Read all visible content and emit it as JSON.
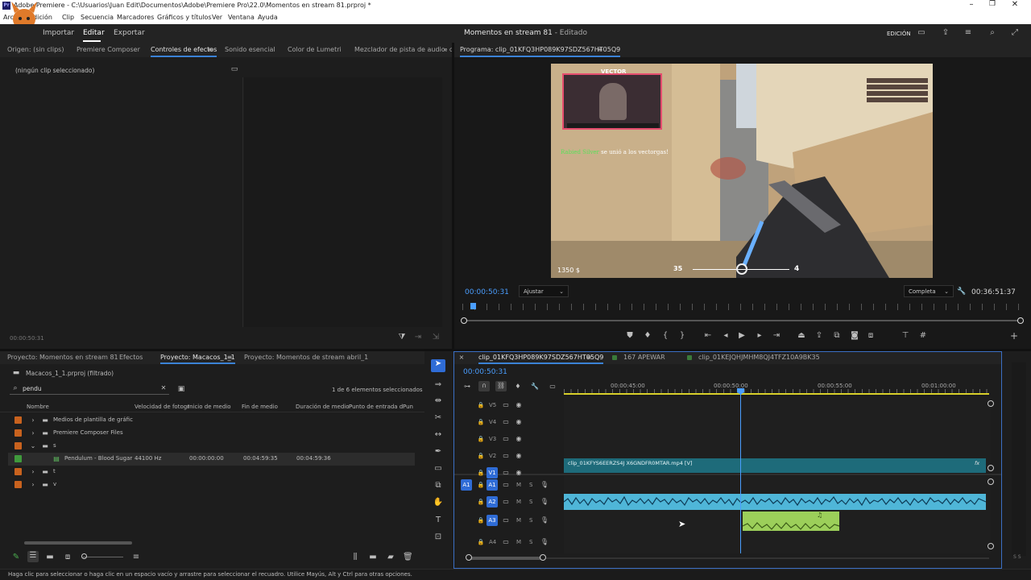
{
  "titlebar": {
    "title": "Adobe Premiere - C:\\Usuarios\\Juan Edit\\Documentos\\Adobe\\Premiere Pro\\22.0\\Momentos en stream 81.prproj *"
  },
  "menu": [
    "Archivo",
    "Edición",
    "Clip",
    "Secuencia",
    "Marcadores",
    "Gráficos y títulos",
    "Ver",
    "Ventana",
    "Ayuda"
  ],
  "app": {
    "tabs": [
      "Importar",
      "Editar",
      "Exportar"
    ],
    "title": "Momentos en stream 81",
    "title_suffix": " - Editado",
    "mode": "EDICIÓN"
  },
  "source_panel": {
    "tabs": [
      "Origen: (sin clips)",
      "Premiere Composer",
      "Controles de efectos",
      "Sonido esencial",
      "Color de Lumetri",
      "Mezclador de pista de audio: clip"
    ],
    "empty_text": "(ningún clip seleccionado)",
    "timecode": "00:00:50:31"
  },
  "program": {
    "title": "Programa: clip_01KFQ3HP089K97SDZ567HT05Q9",
    "timecode": "00:00:50:31",
    "fit": "Ajustar",
    "quality": "Completa",
    "duration": "00:36:51:37",
    "overlay_chat": "se unió a los vectorgas!",
    "overlay_user": "Rabied Silver",
    "overlay_money": "1350 $",
    "overlay_ammo": "35",
    "overlay_score": "4",
    "overlay_brand": "VECTOR"
  },
  "project": {
    "tabs": [
      "Proyecto: Momentos en stream 81",
      "Efectos",
      "Proyecto: Macacos_1_1",
      "Proyecto: Momentos de stream abril_1"
    ],
    "path": "Macacos_1_1.prproj (filtrado)",
    "search": "pendu",
    "count": "1 de 6 elementos seleccionados",
    "columns": [
      "Nombre",
      "Velocidad de fotogr",
      "Inicio de medio",
      "Fin de medio",
      "Duración de medio",
      "Punto de entrada d",
      "Pun"
    ],
    "rows": [
      {
        "name": "Medios de plantilla de gráfic",
        "color": "#c8621e",
        "type": "folder",
        "indent": 1,
        "rate": "",
        "start": "",
        "end": "",
        "dur": ""
      },
      {
        "name": "Premiere Composer Files",
        "color": "#c8621e",
        "type": "folder",
        "indent": 1,
        "rate": "",
        "start": "",
        "end": "",
        "dur": ""
      },
      {
        "name": "s",
        "color": "#c8621e",
        "type": "folder-open",
        "indent": 1,
        "rate": "",
        "start": "",
        "end": "",
        "dur": ""
      },
      {
        "name": "Pendulum - Blood Sugar",
        "color": "#3f9a3c",
        "type": "audio",
        "indent": 2,
        "rate": "44100 Hz",
        "start": "00:00:00:00",
        "end": "00:04:59:35",
        "dur": "00:04:59:36"
      },
      {
        "name": "t",
        "color": "#c8621e",
        "type": "folder",
        "indent": 1,
        "rate": "",
        "start": "",
        "end": "",
        "dur": ""
      },
      {
        "name": "v",
        "color": "#c8621e",
        "type": "folder",
        "indent": 1,
        "rate": "",
        "start": "",
        "end": "",
        "dur": ""
      }
    ]
  },
  "timeline": {
    "tabs": [
      "clip_01KFQ3HP089K97SDZ567HT05Q9",
      "167 APEWAR",
      "clip_01KEJQHJMHM8QJ4TFZ10A9BK35"
    ],
    "timecode": "00:00:50:31",
    "ruler": [
      "00:00:45:00",
      "00:00:50:00",
      "00:00:55:00",
      "00:01:00:00"
    ],
    "video_tracks": [
      "V5",
      "V4",
      "V3",
      "V2",
      "V1"
    ],
    "audio_tracks": [
      "A1",
      "A2",
      "A3",
      "A4"
    ],
    "video_clip": "clip_01KFYS6EERZS4J X6GNDFR0MTAR.mp4 [V]",
    "fx": "fx",
    "ms": "M",
    "s": "S",
    "vu_label": "S S"
  },
  "status": "Haga clic para seleccionar o haga clic en un espacio vacío y arrastre para seleccionar el recuadro. Utilice Mayús, Alt y Ctrl para otras opciones.",
  "colors": {
    "accent": "#2f6cd6",
    "video_clip": "#1e6b7a",
    "audio_clip": "#4fb6d8",
    "music_clip": "#9ccf5a",
    "playhead": "#4a9eff"
  }
}
